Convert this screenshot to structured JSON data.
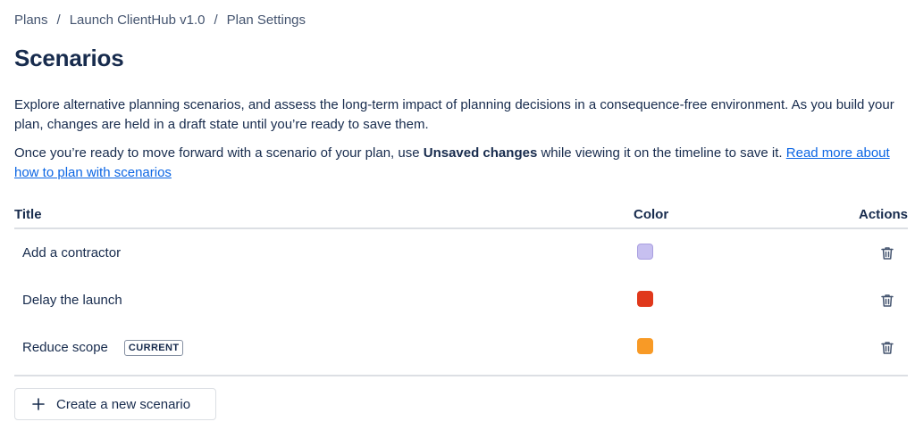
{
  "breadcrumb": {
    "items": [
      "Plans",
      "Launch ClientHub v1.0",
      "Plan Settings"
    ],
    "separator": "/"
  },
  "page": {
    "title": "Scenarios",
    "description_1": "Explore alternative planning scenarios, and assess the long-term impact of planning decisions in a consequence-free environment. As you build your plan, changes are held in a draft state until you’re ready to save them.",
    "description_2_prefix": "Once you’re ready to move forward with a scenario of your plan, use ",
    "description_2_bold": "Unsaved changes",
    "description_2_suffix": " while viewing it on the timeline to save it. ",
    "description_2_link": "Read more about how to plan with scenarios"
  },
  "table": {
    "headers": {
      "title": "Title",
      "color": "Color",
      "actions": "Actions"
    },
    "rows": [
      {
        "title": "Add a contractor",
        "color": "#c7c0f0",
        "border": "#a99fe0",
        "badge": ""
      },
      {
        "title": "Delay the launch",
        "color": "#e0381b",
        "border": "#e0381b",
        "badge": ""
      },
      {
        "title": "Reduce scope",
        "color": "#f89a26",
        "border": "#f89a26",
        "badge": "CURRENT"
      }
    ],
    "row_action_icon": "trash-icon"
  },
  "create_button": {
    "label": "Create a new scenario",
    "icon": "plus-icon"
  }
}
